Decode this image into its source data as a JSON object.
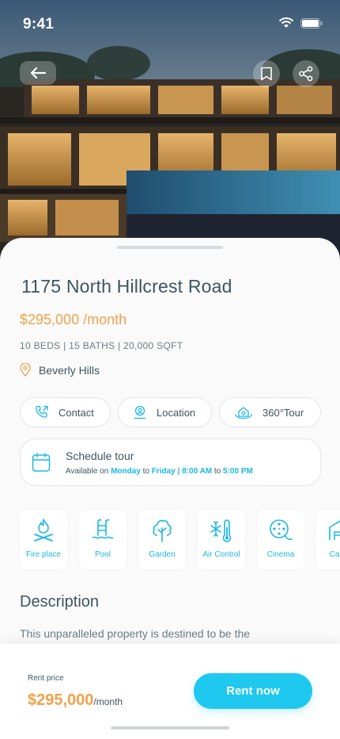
{
  "status_bar": {
    "time": "9:41"
  },
  "property": {
    "title": "1175 North Hillcrest Road",
    "price": "$295,000 /month",
    "specs": "10 BEDS | 15 BATHS | 20,000 SQFT",
    "location": "Beverly Hills"
  },
  "actions": {
    "contact": "Contact",
    "location": "Location",
    "tour": "360°Tour"
  },
  "schedule": {
    "title": "Schedule tour",
    "prefix": "Available on ",
    "day_from": "Monday",
    "to1": " to ",
    "day_to": "Friday | 8:00 AM",
    "to2": " to ",
    "time_to": "5:00 PM"
  },
  "amenities": [
    {
      "label": "Fire place",
      "icon": "fireplace-icon"
    },
    {
      "label": "Pool",
      "icon": "pool-icon"
    },
    {
      "label": "Garden",
      "icon": "tree-icon"
    },
    {
      "label": "Air Control",
      "icon": "snowflake-thermometer-icon"
    },
    {
      "label": "Cinema",
      "icon": "film-reel-icon"
    },
    {
      "label": "Car G",
      "icon": "garage-icon"
    }
  ],
  "description": {
    "title": "Description",
    "text": "This unparalleled property is destined to be the"
  },
  "bottom_bar": {
    "rent_label": "Rent price",
    "rent_price": "$295,000",
    "rent_unit": "/month",
    "rent_button": "Rent now"
  },
  "colors": {
    "accent": "#1ec8ef",
    "price": "#f2a24a",
    "text": "#3e5561"
  }
}
